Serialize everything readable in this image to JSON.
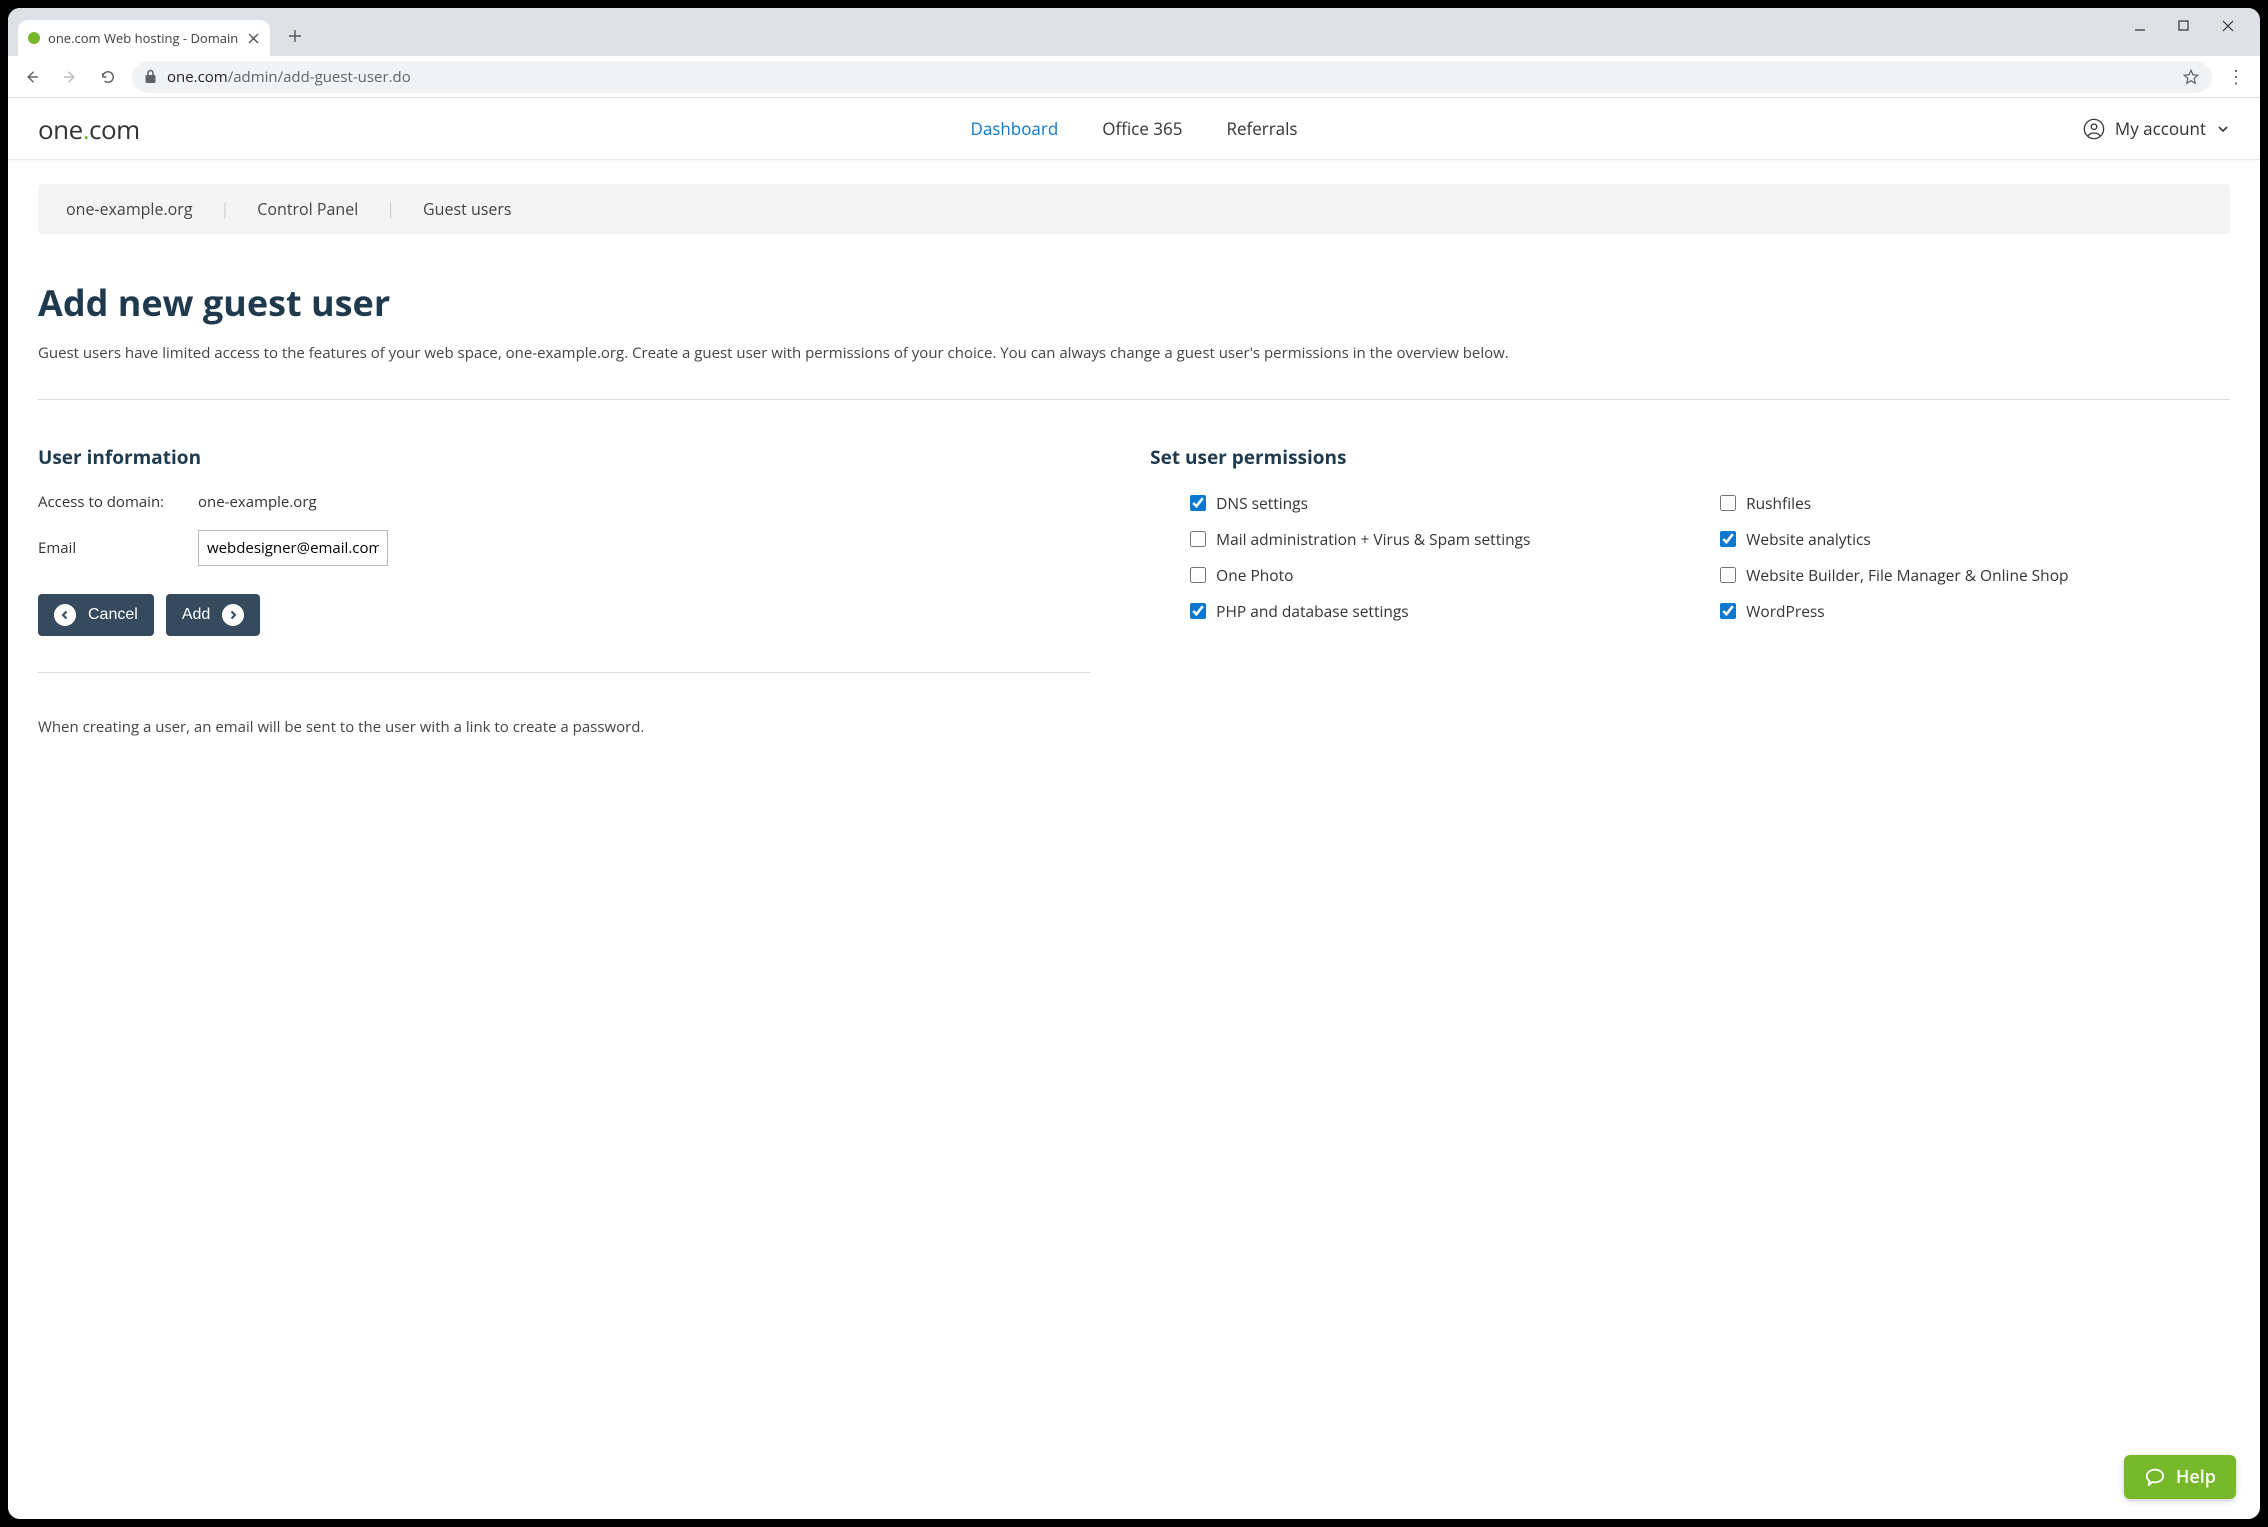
{
  "browser": {
    "tab_title": "one.com Web hosting  -  Domain",
    "url_domain": "one.com",
    "url_path": "/admin/add-guest-user.do"
  },
  "header": {
    "logo_text_pre": "one",
    "logo_text_post": "com",
    "nav": {
      "dashboard": "Dashboard",
      "office365": "Office 365",
      "referrals": "Referrals"
    },
    "account_label": "My account"
  },
  "breadcrumb": {
    "items": [
      "one-example.org",
      "Control Panel",
      "Guest users"
    ]
  },
  "page": {
    "title": "Add new guest user",
    "description": "Guest users have limited access to the features of your web space, one-example.org. Create a guest user with permissions of your choice. You can always change a guest user's permissions in the overview below."
  },
  "user_info": {
    "section_title": "User information",
    "domain_label": "Access to domain:",
    "domain_value": "one-example.org",
    "email_label": "Email",
    "email_value": "webdesigner@email.com"
  },
  "buttons": {
    "cancel": "Cancel",
    "add": "Add"
  },
  "permissions": {
    "section_title": "Set user permissions",
    "items": [
      {
        "label": "DNS settings",
        "checked": true
      },
      {
        "label": "Rushfiles",
        "checked": false
      },
      {
        "label": "Mail administration + Virus & Spam settings",
        "checked": false
      },
      {
        "label": "Website analytics",
        "checked": true
      },
      {
        "label": "One Photo",
        "checked": false
      },
      {
        "label": "Website Builder, File Manager & Online Shop",
        "checked": false
      },
      {
        "label": "PHP and database settings",
        "checked": true
      },
      {
        "label": "WordPress",
        "checked": true
      }
    ]
  },
  "footnote": "When creating a user, an email will be sent to the user with a link to create a password.",
  "help": {
    "label": "Help"
  }
}
